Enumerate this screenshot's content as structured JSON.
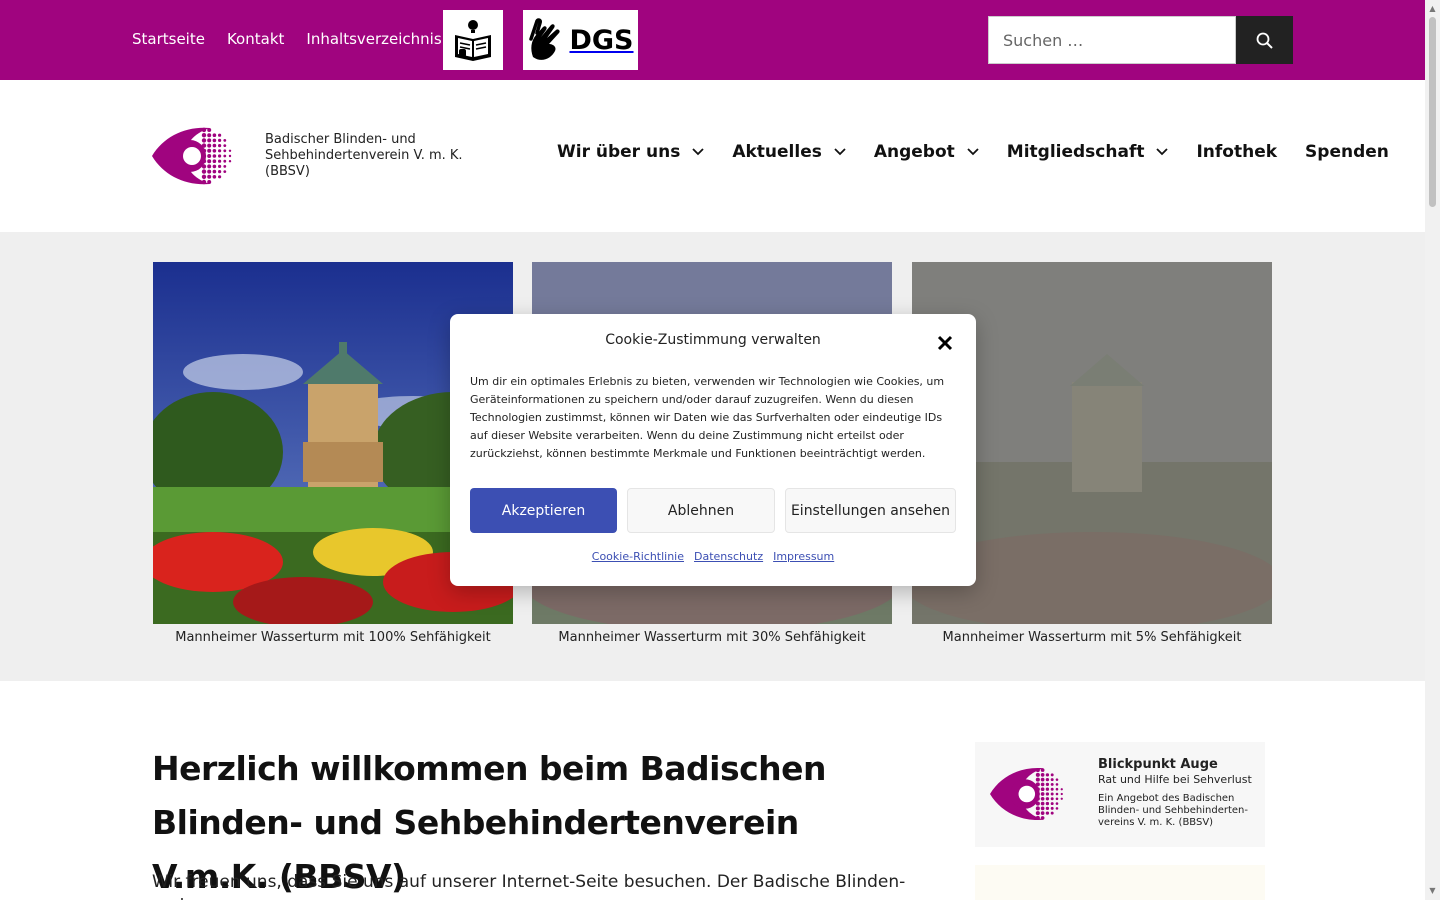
{
  "topbar": {
    "nav": [
      "Startseite",
      "Kontakt",
      "Inhaltsverzeichnis"
    ],
    "dgs_label": "DGS",
    "search_placeholder": "Suchen …",
    "bg_color": "#a0047f"
  },
  "header": {
    "org_name_line1": "Badischer Blinden- und",
    "org_name_line2": "Sehbehindertenverein V. m. K.",
    "org_name_line3": "(BBSV)",
    "nav": [
      {
        "label": "Wir über uns",
        "has_dropdown": true
      },
      {
        "label": "Aktuelles",
        "has_dropdown": true
      },
      {
        "label": "Angebot",
        "has_dropdown": true
      },
      {
        "label": "Mitgliedschaft",
        "has_dropdown": true
      },
      {
        "label": "Infothek",
        "has_dropdown": false
      },
      {
        "label": "Spenden",
        "has_dropdown": false
      }
    ]
  },
  "gallery": {
    "captions": [
      "Mannheimer Wasserturm mit 100% Sehfähigkeit",
      "Mannheimer Wasserturm mit 30% Sehfähigkeit",
      "Mannheimer Wasserturm mit 5% Sehfähigkeit"
    ]
  },
  "main": {
    "title": "Herzlich willkommen beim Badischen Blinden- und Sehbehindertenverein V.m.K. (BBSV)",
    "intro": "Wir freuen uns, dass Sie uns auf unserer Internet-Seite besuchen. Der Badische Blinden- und"
  },
  "aside": {
    "title": "Blickpunkt Auge",
    "subtitle": "Rat und Hilfe bei Sehverlust",
    "desc_line1": "Ein Angebot des Badischen",
    "desc_line2": "Blinden- und Sehbehinderten-",
    "desc_line3": "vereins V. m. K. (BBSV)"
  },
  "cookie_modal": {
    "title": "Cookie-Zustimmung verwalten",
    "text": "Um dir ein optimales Erlebnis zu bieten, verwenden wir Technologien wie Cookies, um Geräteinformationen zu speichern und/oder darauf zuzugreifen. Wenn du diesen Technologien zustimmst, können wir Daten wie das Surfverhalten oder eindeutige IDs auf dieser Website verarbeiten. Wenn du deine Zustimmung nicht erteilst oder zurückziehst, können bestimmte Merkmale und Funktionen beeinträchtigt werden.",
    "accept": "Akzeptieren",
    "deny": "Ablehnen",
    "settings": "Einstellungen ansehen",
    "links": [
      "Cookie-Richtlinie",
      "Datenschutz",
      "Impressum"
    ],
    "accent_color": "#3c4fb3"
  }
}
